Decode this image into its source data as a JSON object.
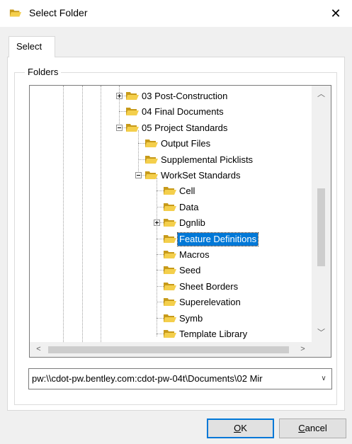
{
  "window": {
    "title": "Select Folder",
    "close_glyph": "✕"
  },
  "tab": {
    "label": "Select"
  },
  "group": {
    "label": "Folders"
  },
  "tree": {
    "items": [
      {
        "label": "03 Post-Construction",
        "icon": "folder-icon",
        "expander": "plus"
      },
      {
        "label": "04 Final Documents",
        "icon": "folder-icon",
        "expander": "none"
      },
      {
        "label": "05 Project Standards",
        "icon": "folder-icon",
        "expander": "minus"
      },
      {
        "label": "Output Files",
        "icon": "folder-icon",
        "expander": "none"
      },
      {
        "label": "Supplemental Picklists",
        "icon": "folder-icon",
        "expander": "none"
      },
      {
        "label": "WorkSet Standards",
        "icon": "folder-icon",
        "expander": "minus"
      },
      {
        "label": "Cell",
        "icon": "folder-icon",
        "expander": "none"
      },
      {
        "label": "Data",
        "icon": "folder-icon",
        "expander": "none"
      },
      {
        "label": "Dgnlib",
        "icon": "folder-icon",
        "expander": "plus"
      },
      {
        "label": "Feature Definitions",
        "icon": "folder-icon",
        "expander": "none",
        "selected": true
      },
      {
        "label": "Macros",
        "icon": "folder-icon",
        "expander": "none"
      },
      {
        "label": "Seed",
        "icon": "folder-icon",
        "expander": "none"
      },
      {
        "label": "Sheet Borders",
        "icon": "folder-icon",
        "expander": "none"
      },
      {
        "label": "Superelevation",
        "icon": "folder-icon",
        "expander": "none"
      },
      {
        "label": "Symb",
        "icon": "folder-icon",
        "expander": "none"
      },
      {
        "label": "Template Library",
        "icon": "folder-icon",
        "expander": "none"
      }
    ],
    "vscroll": {
      "up_glyph": "︿",
      "down_glyph": "﹀"
    },
    "hscroll": {
      "left_glyph": "<",
      "right_glyph": ">"
    }
  },
  "path": {
    "value": "pw:\\\\cdot-pw.bentley.com:cdot-pw-04t\\Documents\\02 Mir",
    "dropdown_glyph": "∨"
  },
  "buttons": {
    "ok": {
      "mnemonic": "O",
      "rest": "K"
    },
    "cancel": {
      "mnemonic": "C",
      "rest": "ancel"
    }
  },
  "colors": {
    "selection": "#0078d7",
    "folder": "#f4cf4c",
    "folder_dark": "#c79a1a"
  }
}
